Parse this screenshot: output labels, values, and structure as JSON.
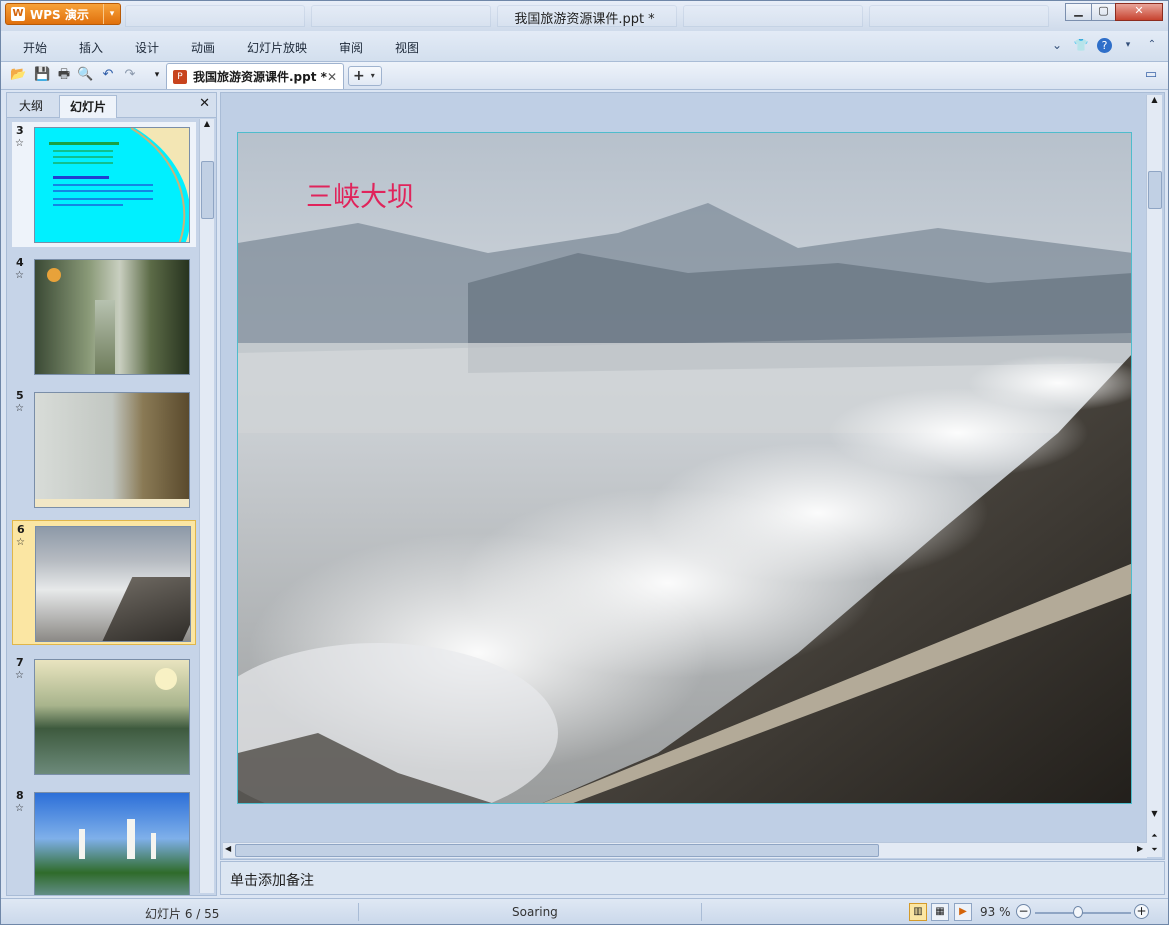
{
  "app": {
    "brand": "WPS 演示",
    "window_title": "我国旅游资源课件.ppt *",
    "logo_letter": "W"
  },
  "menu": {
    "items": [
      "开始",
      "插入",
      "设计",
      "动画",
      "幻灯片放映",
      "审阅",
      "视图"
    ]
  },
  "document_tab": {
    "label": "我国旅游资源课件.ppt *",
    "icon": "ppt-file-icon"
  },
  "left_panel": {
    "tabs": [
      "大纲",
      "幻灯片"
    ],
    "active_tab": "幻灯片",
    "slides": [
      {
        "num": "3",
        "caption": "",
        "selected": false
      },
      {
        "num": "4",
        "caption": "",
        "selected": false
      },
      {
        "num": "5",
        "caption": "",
        "selected": false
      },
      {
        "num": "6",
        "caption": "",
        "selected": true
      },
      {
        "num": "7",
        "caption": "",
        "selected": false
      },
      {
        "num": "8",
        "caption": "",
        "selected": false
      }
    ],
    "star_icon": "☆"
  },
  "slide": {
    "title": "三峡大坝"
  },
  "notes": {
    "placeholder": "单击添加备注"
  },
  "status": {
    "slide_counter": "幻灯片 6 / 55",
    "theme": "Soaring",
    "zoom": "93 %",
    "zoom_level_fraction": 0.46
  },
  "colors": {
    "accent_orange": "#e0700c",
    "title_red": "#e0245b",
    "selection": "#fbe6a3"
  }
}
